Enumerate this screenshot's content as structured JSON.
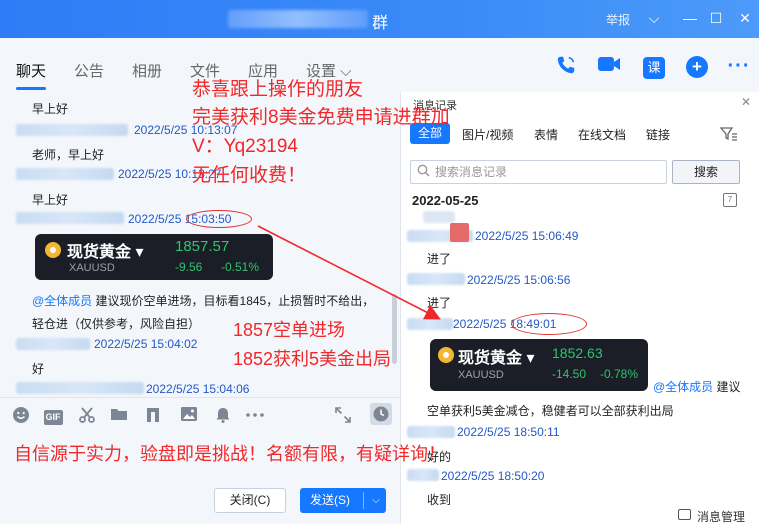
{
  "window": {
    "title_suffix": "群",
    "report_label": "举报",
    "controls": {
      "dropdown": "⌵",
      "minimize": "—",
      "maximize": "☐",
      "close": "✕"
    }
  },
  "tabs": [
    "聊天",
    "公告",
    "相册",
    "文件",
    "应用",
    "设置 ⌵"
  ],
  "chat": {
    "messages": [
      {
        "text": "早上好"
      },
      {
        "time": "2022/5/25 10:13:07",
        "text": "老师，早上好"
      },
      {
        "time": "2022/5/25 10:13:27",
        "text": "早上好"
      },
      {
        "time": "2022/5/25 15:03:50"
      },
      {
        "mention": "@全体成员",
        "text": " 建议现价空单进场，目标看1845，止损暂时不给出，轻仓进（仅供参考，风险自担）"
      },
      {
        "time": "2022/5/25 15:04:02",
        "text": "好"
      },
      {
        "time": "2022/5/25 15:04:06"
      }
    ],
    "gold_card": {
      "name": "现货黄金 ▾",
      "symbol": "XAUUSD",
      "price": "1857.57",
      "change": "-9.56",
      "change_pct": "-0.51%"
    }
  },
  "toolbar": {
    "icons": [
      "emoji-icon",
      "gif-icon",
      "scissors-icon",
      "folder-icon",
      "music-icon",
      "image-icon",
      "bell-icon",
      "more-icon",
      "expand-icon",
      "clock-icon"
    ],
    "gif": "GIF"
  },
  "actions": {
    "close_label": "关闭(C)",
    "send_label": "发送(S)",
    "send_arrow": "⌵"
  },
  "history": {
    "title": "消息记录",
    "close": "✕",
    "filters": [
      "全部",
      "图片/视频",
      "表情",
      "在线文档",
      "链接"
    ],
    "search_placeholder": "搜索消息记录",
    "search_button": "搜索",
    "date": "2022-05-25",
    "calendar_day": "7",
    "messages": [
      {
        "time": "2022/5/25 15:06:49",
        "text": "进了"
      },
      {
        "time": "2022/5/25 15:06:56",
        "text": "进了"
      },
      {
        "time": "2022/5/25 18:49:01"
      },
      {
        "mention": "@全体成员",
        "text": " 建议"
      },
      {
        "text": "空单获利5美金减仓，稳健者可以全部获利出局"
      },
      {
        "time": "2022/5/25 18:50:11",
        "text": "好的"
      },
      {
        "time": "2022/5/25 18:50:20",
        "text": "收到"
      }
    ],
    "gold_card": {
      "name": "现货黄金 ▾",
      "symbol": "XAUUSD",
      "price": "1852.63",
      "change": "-14.50",
      "change_pct": "-0.78%"
    },
    "footer": "消息管理"
  },
  "overlay": {
    "line1": "恭喜跟上操作的朋友",
    "line2": "完美获利8美金免费申请进群加",
    "line3": "V：Yq23194",
    "line4": "无任何收费！",
    "trade1": "1857空单进场",
    "trade2": "1852获利5美金出局",
    "bottom": "自信源于实力，验盘即是挑战！名额有限，有疑详询！"
  },
  "colors": {
    "accent": "#1677ff",
    "overlay": "#f0282a",
    "gain": "#2fc46c",
    "card": "#1b1e26"
  }
}
